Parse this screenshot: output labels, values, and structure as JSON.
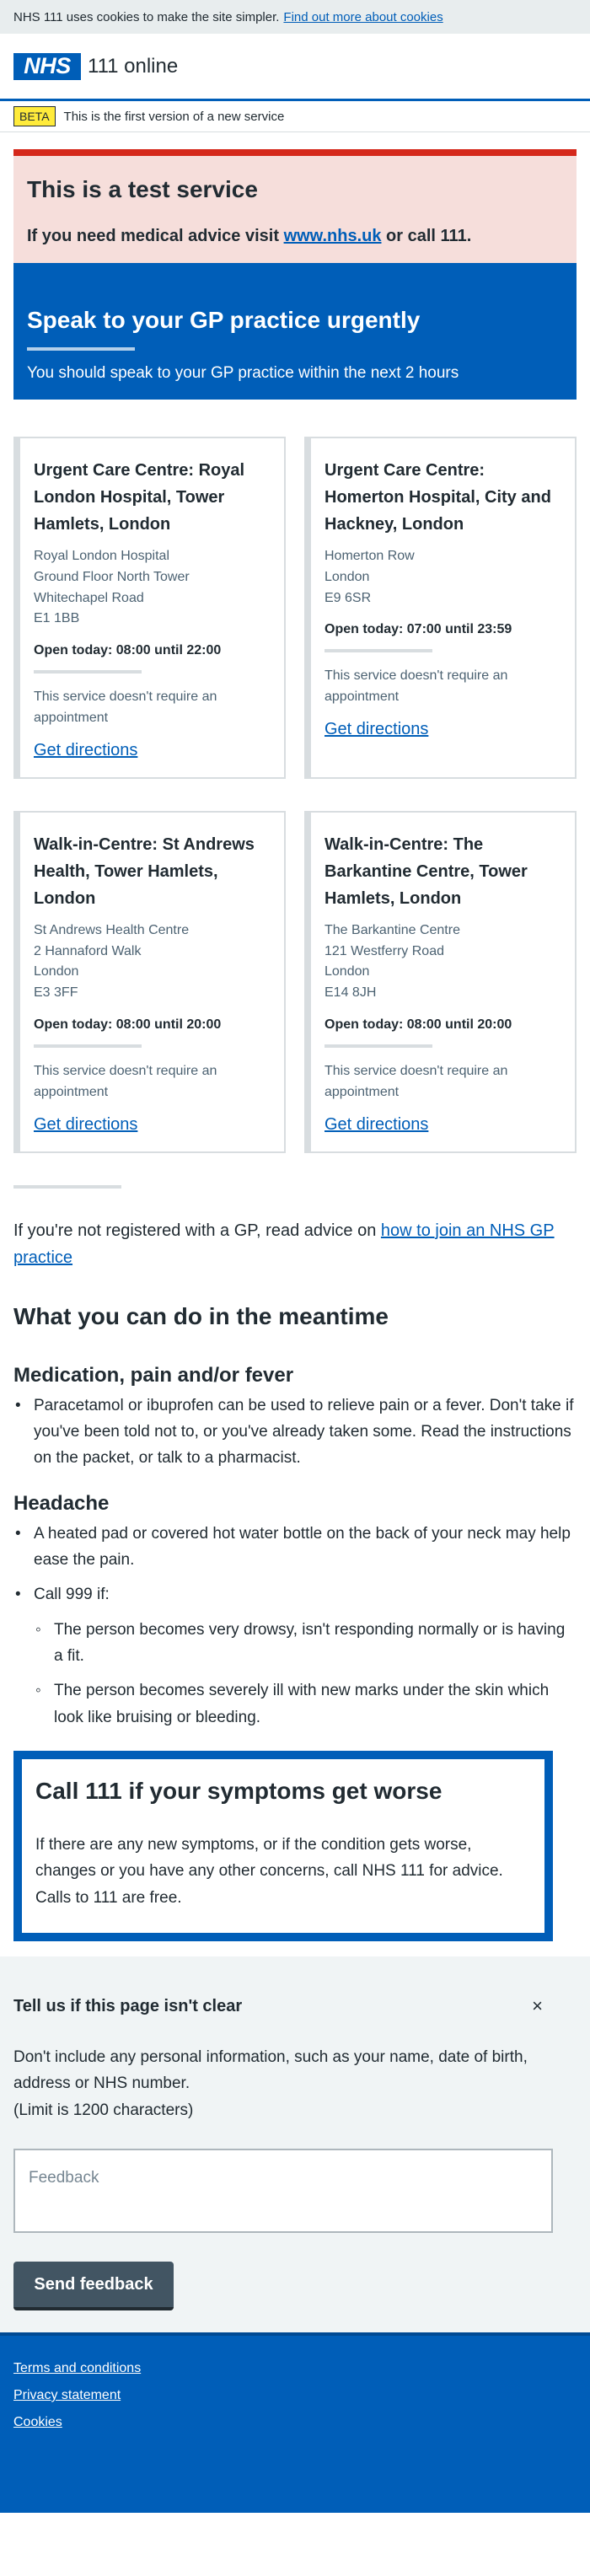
{
  "cookie_banner": {
    "text": "NHS 111 uses cookies to make the site simpler.",
    "link": "Find out more about cookies"
  },
  "header": {
    "logo_text": "NHS",
    "service_name": "111 online"
  },
  "phase": {
    "tag": "BETA",
    "text": "This is the first version of a new service"
  },
  "test_warning": {
    "title": "This is a test service",
    "prefix": "If you need medical advice visit ",
    "link": "www.nhs.uk",
    "suffix": " or call 111."
  },
  "care_advice": {
    "title": "Speak to your GP practice urgently",
    "text": "You should speak to your GP practice within the next 2 hours"
  },
  "services": [
    {
      "name": "Urgent Care Centre: Royal London Hospital, Tower Hamlets, London",
      "address": [
        "Royal London Hospital",
        "Ground Floor North Tower",
        "Whitechapel Road",
        "E1 1BB"
      ],
      "hours": "Open today: 08:00 until 22:00",
      "appointment": "This service doesn't require an appointment",
      "directions": "Get directions"
    },
    {
      "name": "Urgent Care Centre: Homerton Hospital, City and Hackney, London",
      "address": [
        "Homerton Row",
        "London",
        "E9 6SR"
      ],
      "hours": "Open today: 07:00 until 23:59",
      "appointment": "This service doesn't require an appointment",
      "directions": "Get directions"
    },
    {
      "name": "Walk-in-Centre: St Andrews Health, Tower Hamlets, London",
      "address": [
        "St Andrews Health Centre",
        "2 Hannaford Walk",
        "London",
        "E3 3FF"
      ],
      "hours": "Open today: 08:00 until 20:00",
      "appointment": "This service doesn't require an appointment",
      "directions": "Get directions"
    },
    {
      "name": "Walk-in-Centre: The Barkantine Centre, Tower Hamlets, London",
      "address": [
        "The Barkantine Centre",
        "121 Westferry Road",
        "London",
        "E14 8JH"
      ],
      "hours": "Open today: 08:00 until 20:00",
      "appointment": "This service doesn't require an appointment",
      "directions": "Get directions"
    }
  ],
  "gp_advice": {
    "prefix": "If you're not registered with a GP, read advice on ",
    "link": "how to join an NHS GP practice"
  },
  "meantime": {
    "title": "What you can do in the meantime",
    "medication": {
      "title": "Medication, pain and/or fever",
      "items": [
        "Paracetamol or ibuprofen can be used to relieve pain or a fever. Don't take if you've been told not to, or you've already taken some. Read the instructions on the packet, or talk to a pharmacist."
      ]
    },
    "headache": {
      "title": "Headache",
      "item1": "A heated pad or covered hot water bottle on the back of your neck may help ease the pain.",
      "item2": "Call 999 if:",
      "sub_items": [
        "The person becomes very drowsy, isn't responding normally or is having a fit.",
        "The person becomes severely ill with new marks under the skin which look like bruising or bleeding."
      ]
    }
  },
  "worsening": {
    "title": "Call 111 if your symptoms get worse",
    "text": "If there are any new symptoms, or if the condition gets worse, changes or you have any other concerns, call NHS 111 for advice. Calls to 111 are free."
  },
  "feedback": {
    "title": "Tell us if this page isn't clear",
    "close": "×",
    "line1": "Don't include any personal information, such as your name, date of birth, address or NHS number.",
    "line2": "(Limit is 1200 characters)",
    "placeholder": "Feedback",
    "button": "Send feedback"
  },
  "footer": {
    "links": [
      "Terms and conditions",
      "Privacy statement",
      "Cookies"
    ]
  },
  "colors": {
    "nhs_blue": "#005eb8",
    "warning_red": "#d5281b",
    "beta_yellow": "#ffeb3b"
  }
}
